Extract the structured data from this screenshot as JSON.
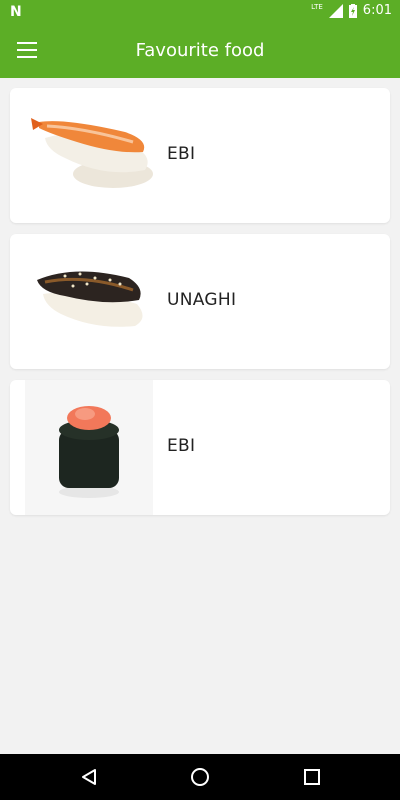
{
  "status_bar": {
    "logo": "N",
    "network": "LTE",
    "time": "6:01"
  },
  "app_bar": {
    "title": "Favourite food",
    "menu_icon": "hamburger-menu-icon"
  },
  "foods": [
    {
      "name": "EBI",
      "image": "shrimp-nigiri"
    },
    {
      "name": "UNAGHI",
      "image": "eel-nigiri"
    },
    {
      "name": "EBI",
      "image": "shrimp-gunkan"
    }
  ],
  "nav_bar": {
    "buttons": [
      "back-icon",
      "home-icon",
      "recents-icon"
    ]
  },
  "colors": {
    "accent": "#5cae26",
    "background": "#f2f2f2",
    "card": "#ffffff"
  }
}
